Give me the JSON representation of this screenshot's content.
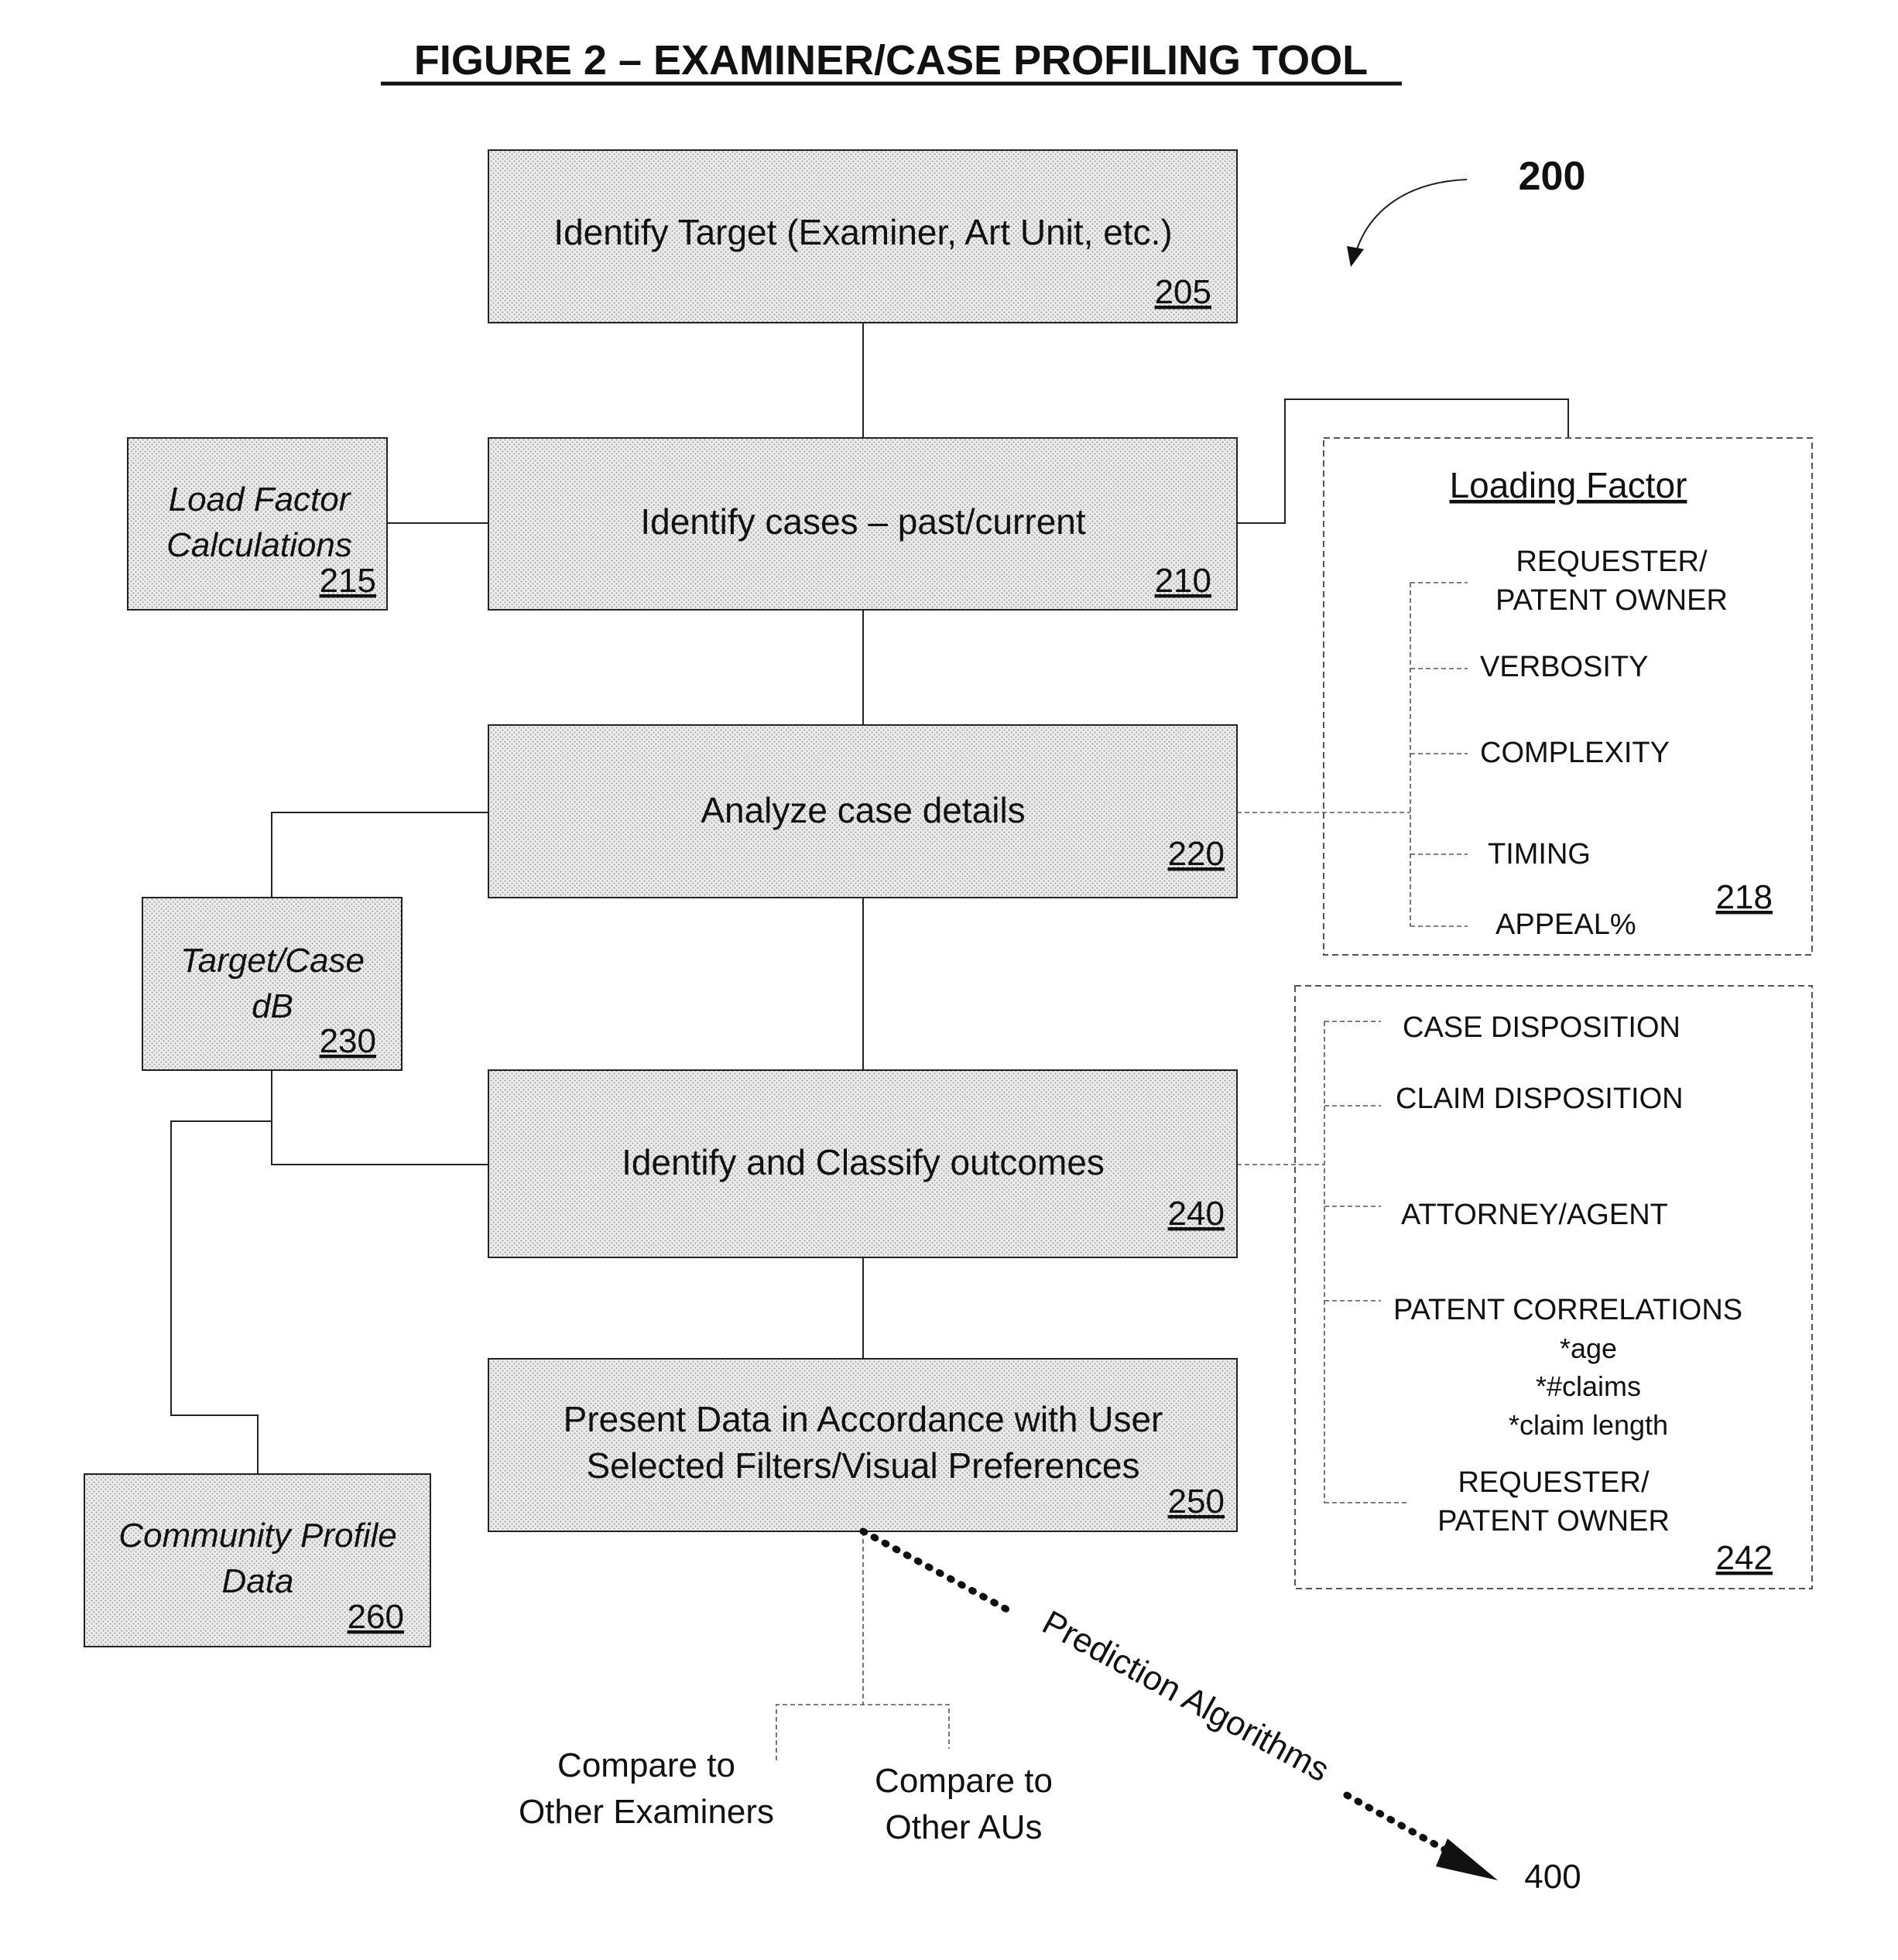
{
  "title": "FIGURE 2 – EXAMINER/CASE PROFILING TOOL",
  "figure_ref": "200",
  "steps": [
    {
      "id": "205",
      "label_lines": [
        "Identify Target (Examiner, Art Unit, etc.)"
      ]
    },
    {
      "id": "210",
      "label_lines": [
        "Identify cases – past/current"
      ]
    },
    {
      "id": "220",
      "label_lines": [
        "Analyze case details"
      ]
    },
    {
      "id": "240",
      "label_lines": [
        "Identify and Classify outcomes"
      ]
    },
    {
      "id": "250",
      "label_lines": [
        "Present Data in Accordance with User",
        "Selected Filters/Visual Preferences"
      ]
    }
  ],
  "side_boxes": [
    {
      "id": "215",
      "label_lines": [
        "Load Factor",
        "Calculations"
      ]
    },
    {
      "id": "230",
      "label_lines": [
        "Target/Case",
        "dB"
      ]
    },
    {
      "id": "260",
      "label_lines": [
        "Community Profile",
        "Data"
      ]
    }
  ],
  "loading_factor": {
    "id": "218",
    "heading": "Loading Factor",
    "items": [
      {
        "lines": [
          "REQUESTER/",
          "PATENT OWNER"
        ]
      },
      {
        "lines": [
          "VERBOSITY"
        ]
      },
      {
        "lines": [
          "COMPLEXITY"
        ]
      },
      {
        "lines": [
          "TIMING"
        ]
      },
      {
        "lines": [
          "APPEAL%"
        ]
      }
    ]
  },
  "outcomes": {
    "id": "242",
    "items": [
      {
        "lines": [
          "CASE DISPOSITION"
        ]
      },
      {
        "lines": [
          "CLAIM DISPOSITION"
        ]
      },
      {
        "lines": [
          "ATTORNEY/AGENT"
        ]
      },
      {
        "lines": [
          "PATENT CORRELATIONS",
          "*age",
          "*#claims",
          "*claim length"
        ]
      },
      {
        "lines": [
          "REQUESTER/",
          "PATENT OWNER"
        ]
      }
    ]
  },
  "compare": [
    {
      "lines": [
        "Compare to",
        "Other Examiners"
      ]
    },
    {
      "lines": [
        "Compare to",
        "Other AUs"
      ]
    }
  ],
  "prediction": {
    "label": "Prediction Algorithms",
    "target": "400"
  }
}
